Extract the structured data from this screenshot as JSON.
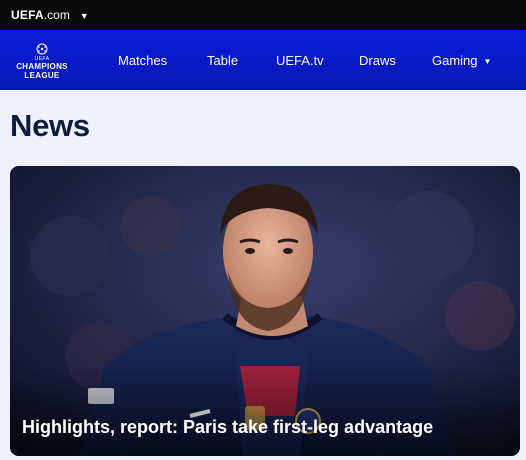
{
  "topbar": {
    "brand_bold": "UEFA",
    "brand_suffix": ".com",
    "dropdown_icon": "caret-down-icon"
  },
  "logo": {
    "line1": "UEFA",
    "line2": "CHAMPIONS",
    "line3": "LEAGUE"
  },
  "nav": {
    "items": [
      {
        "label": "Matches"
      },
      {
        "label": "Table"
      },
      {
        "label": "UEFA.tv"
      },
      {
        "label": "Draws"
      },
      {
        "label": "Gaming"
      }
    ],
    "gaming_dropdown_icon": "caret-down-icon"
  },
  "page": {
    "title": "News"
  },
  "card": {
    "headline": "Highlights, report: Paris take first-leg advantage"
  },
  "colors": {
    "topbar": "#0a0a0a",
    "navbar": "#0a1bd8",
    "background": "#eef1f7",
    "title": "#0c1b3f"
  }
}
